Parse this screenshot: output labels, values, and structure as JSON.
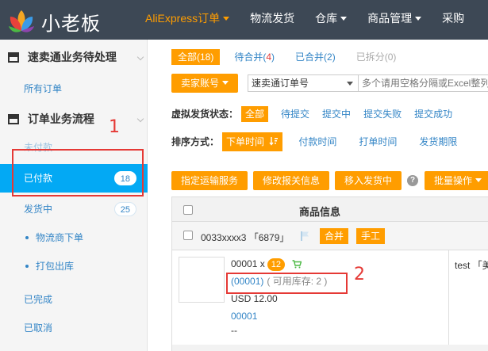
{
  "app": {
    "name": "小老板"
  },
  "nav": {
    "items": [
      {
        "label": "AliExpress订单",
        "dropdown": true,
        "active": true
      },
      {
        "label": "物流发货",
        "dropdown": false,
        "active": false
      },
      {
        "label": "仓库",
        "dropdown": true,
        "active": false
      },
      {
        "label": "商品管理",
        "dropdown": true,
        "active": false
      },
      {
        "label": "采购",
        "dropdown": false,
        "active": false
      }
    ]
  },
  "sidebar": {
    "section1": "速卖通业务待处理",
    "all_orders": "所有订单",
    "section2": "订单业务流程",
    "unpaid": "未付款",
    "paid": {
      "label": "已付款",
      "count": "18"
    },
    "shipping": {
      "label": "发货中",
      "count": "25"
    },
    "carrier_order": "物流商下单",
    "pack_out": "打包出库",
    "completed": "已完成",
    "cancelled": "已取消"
  },
  "annotations": {
    "one": "1",
    "two": "2"
  },
  "tabs": [
    {
      "label": "全部(18)",
      "active": true
    },
    {
      "label": "待合并(",
      "count": "4",
      "suffix": ")",
      "active": false
    },
    {
      "label": "已合并(2)",
      "active": false
    },
    {
      "label": "已拆分(0)",
      "active": false
    }
  ],
  "search": {
    "seller_account_button": "卖家账号",
    "field_select": "速卖通订单号",
    "placeholder": "多个请用空格分隔或Excel整列粘贴"
  },
  "virtual_ship": {
    "label": "虚拟发货状态：",
    "options": [
      "全部",
      "待提交",
      "提交中",
      "提交失败",
      "提交成功"
    ]
  },
  "sort": {
    "label": "排序方式：",
    "active": "下单时间",
    "options": [
      "付款时间",
      "打单时间",
      "发货期限"
    ]
  },
  "actions": {
    "assign_shipping": "指定运输服务",
    "edit_customs": "修改报关信息",
    "move_to_shipping": "移入发货中",
    "help": "?",
    "bulk": "批量操作"
  },
  "table": {
    "header": "商品信息",
    "group": {
      "order_no": "0033xxxx3 「6879」",
      "tags": [
        "合并",
        "手工"
      ]
    },
    "item": {
      "sku_line": "00001 x",
      "qty": "12",
      "sku_link": "(00001)",
      "stock": "( 可用库存: 2 )",
      "price": "USD 12.00",
      "code": "00001",
      "dash": "--",
      "right_text": "test 「美"
    }
  },
  "colors": {
    "accent": "#ff9d00",
    "topbar": "#3d4855",
    "active_item": "#03a9f4",
    "link": "#3385c6",
    "annotation": "#e53935"
  }
}
